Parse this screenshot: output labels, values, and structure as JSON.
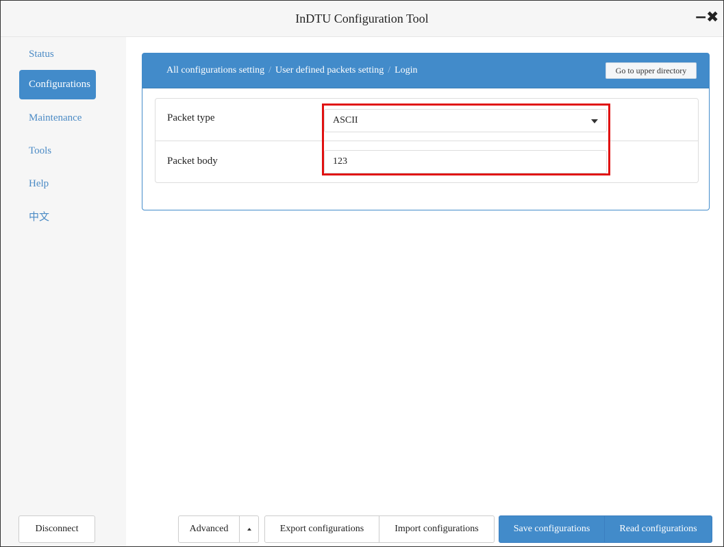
{
  "window": {
    "title": "InDTU Configuration Tool",
    "minimize_glyph": "−",
    "close_glyph": "✖"
  },
  "sidebar": {
    "items": [
      {
        "label": "Status"
      },
      {
        "label": "Configurations",
        "active": true
      },
      {
        "label": "Maintenance"
      },
      {
        "label": "Tools"
      },
      {
        "label": "Help"
      },
      {
        "label": "中文"
      }
    ]
  },
  "panel": {
    "breadcrumb": [
      "All configurations setting",
      "User defined packets setting",
      "Login"
    ],
    "breadcrumb_separator": "/",
    "upper_button": "Go to upper directory",
    "fields": {
      "packet_type": {
        "label": "Packet type",
        "value": "ASCII"
      },
      "packet_body": {
        "label": "Packet body",
        "value": "123"
      }
    },
    "accent_color": "#428bca",
    "highlight_color": "#e01010"
  },
  "footer": {
    "disconnect": "Disconnect",
    "advanced": "Advanced",
    "export": "Export configurations",
    "import": "Import configurations",
    "save": "Save configurations",
    "read": "Read configurations"
  }
}
